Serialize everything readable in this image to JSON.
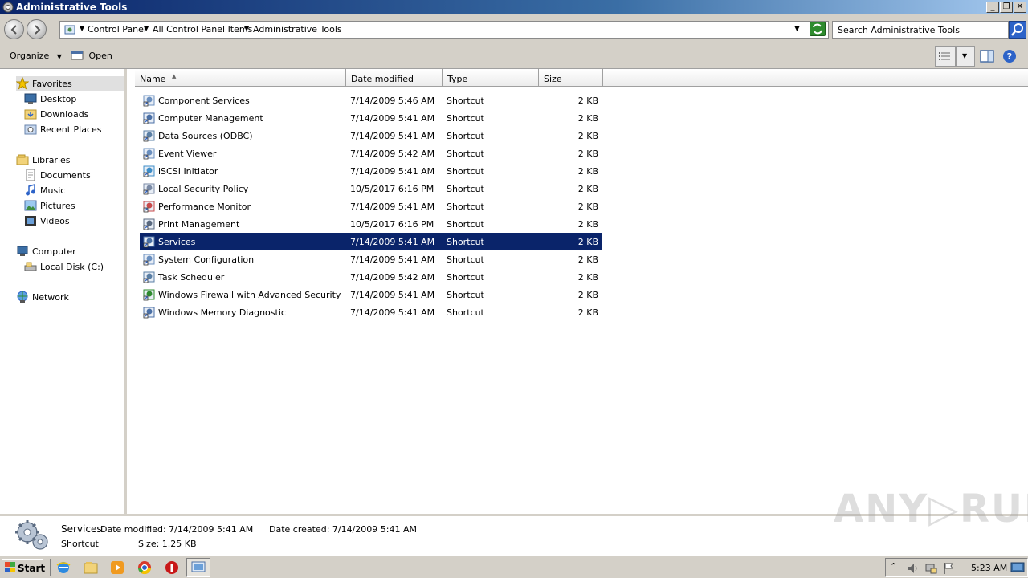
{
  "window": {
    "title": "Administrative Tools",
    "minimize_glyph": "_",
    "restore_glyph": "❐",
    "close_glyph": "✕"
  },
  "address": {
    "crumbs": [
      "Control Panel",
      "All Control Panel Items",
      "Administrative Tools"
    ],
    "search_placeholder": "Search Administrative Tools"
  },
  "commands": {
    "organize": "Organize",
    "open": "Open"
  },
  "nav": {
    "favorites": "Favorites",
    "desktop": "Desktop",
    "downloads": "Downloads",
    "recent_places": "Recent Places",
    "libraries": "Libraries",
    "documents": "Documents",
    "music": "Music",
    "pictures": "Pictures",
    "videos": "Videos",
    "computer": "Computer",
    "local_disk": "Local Disk (C:)",
    "network": "Network"
  },
  "columns": {
    "name": "Name",
    "date_modified": "Date modified",
    "type": "Type",
    "size": "Size"
  },
  "files": [
    {
      "name": "Component Services",
      "date": "7/14/2009 5:46 AM",
      "type": "Shortcut",
      "size": "2 KB"
    },
    {
      "name": "Computer Management",
      "date": "7/14/2009 5:41 AM",
      "type": "Shortcut",
      "size": "2 KB"
    },
    {
      "name": "Data Sources (ODBC)",
      "date": "7/14/2009 5:41 AM",
      "type": "Shortcut",
      "size": "2 KB"
    },
    {
      "name": "Event Viewer",
      "date": "7/14/2009 5:42 AM",
      "type": "Shortcut",
      "size": "2 KB"
    },
    {
      "name": "iSCSI Initiator",
      "date": "7/14/2009 5:41 AM",
      "type": "Shortcut",
      "size": "2 KB"
    },
    {
      "name": "Local Security Policy",
      "date": "10/5/2017 6:16 PM",
      "type": "Shortcut",
      "size": "2 KB"
    },
    {
      "name": "Performance Monitor",
      "date": "7/14/2009 5:41 AM",
      "type": "Shortcut",
      "size": "2 KB"
    },
    {
      "name": "Print Management",
      "date": "10/5/2017 6:16 PM",
      "type": "Shortcut",
      "size": "2 KB"
    },
    {
      "name": "Services",
      "date": "7/14/2009 5:41 AM",
      "type": "Shortcut",
      "size": "2 KB"
    },
    {
      "name": "System Configuration",
      "date": "7/14/2009 5:41 AM",
      "type": "Shortcut",
      "size": "2 KB"
    },
    {
      "name": "Task Scheduler",
      "date": "7/14/2009 5:42 AM",
      "type": "Shortcut",
      "size": "2 KB"
    },
    {
      "name": "Windows Firewall with Advanced Security",
      "date": "7/14/2009 5:41 AM",
      "type": "Shortcut",
      "size": "2 KB"
    },
    {
      "name": "Windows Memory Diagnostic",
      "date": "7/14/2009 5:41 AM",
      "type": "Shortcut",
      "size": "2 KB"
    }
  ],
  "selected_index": 8,
  "details": {
    "name": "Services",
    "type": "Shortcut",
    "date_modified": "Date modified: 7/14/2009 5:41 AM",
    "size": "Size: 1.25 KB",
    "date_created": "Date created: 7/14/2009 5:41 AM"
  },
  "watermark": "ANY▷RUN",
  "taskbar": {
    "start": "Start",
    "clock": "5:23 AM"
  },
  "colors": {
    "selection": "#0a246a",
    "titlebar": "#0a246a",
    "face": "#d4d0c8"
  }
}
